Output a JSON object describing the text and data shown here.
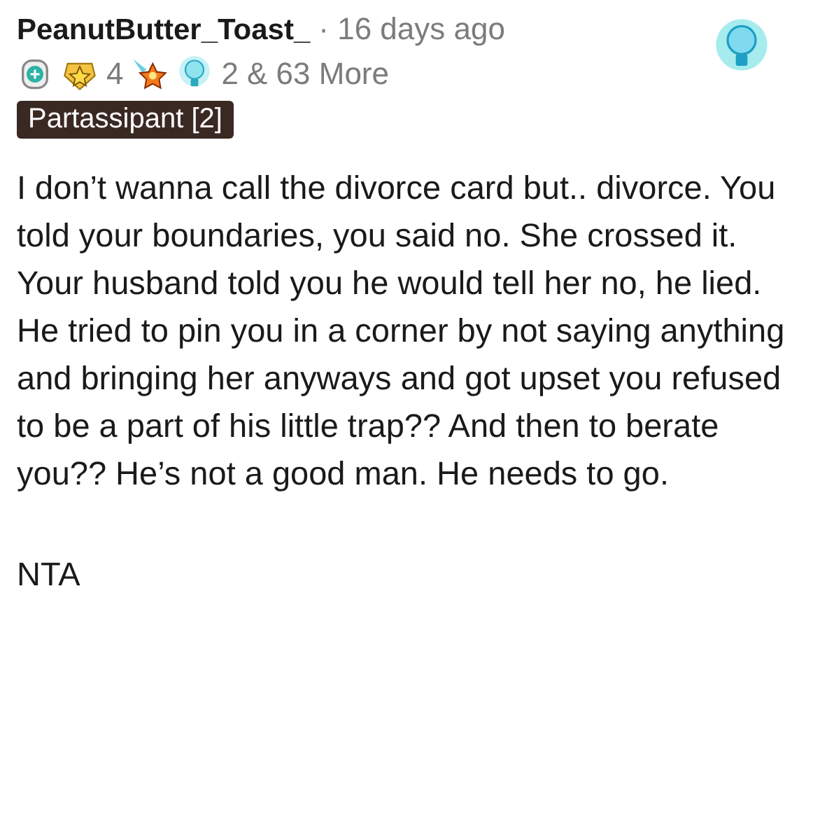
{
  "comment": {
    "author": "PeanutButter_Toast_",
    "time": "· 16 days ago",
    "awards": [
      {
        "kind": "medal"
      },
      {
        "kind": "star-medal",
        "count": "4"
      },
      {
        "kind": "shooting-star"
      },
      {
        "kind": "bulb",
        "count": "2"
      }
    ],
    "more": "& 63 More",
    "flair": "Partassipant [2]",
    "paragraphs": [
      "I don’t wanna call the divorce card but.. divorce. You told your boundaries, you said no. She crossed it. Your husband told you he would tell her no, he lied. He tried to pin you in a corner by not saying anything and bringing her anyways and got upset you refused to be a part of his little trap?? And then to berate you?? He’s not a good man. He needs to go.",
      "NTA"
    ]
  }
}
